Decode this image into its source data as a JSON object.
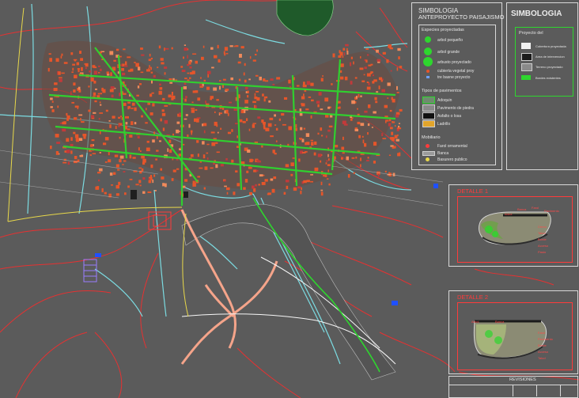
{
  "legend_left": {
    "title_line1": "SIMBOLOGIA",
    "title_line2": "ANTEPROYECTO PAISAJISMO",
    "section_species": "Especies proyectadas",
    "species": [
      "arbol pequeño",
      "arbol grande",
      "arbusto proyectado",
      "cubierta vegetal proy",
      "tre basne proyecto"
    ],
    "section_pavements": "Tipos de pavimentos",
    "pavements": [
      "Adoquin",
      "Pavimento de piedra",
      "Asfalto o losa",
      "Ladrillo"
    ],
    "section_furniture": "Mobiliario",
    "furniture": [
      "Farol ornamental",
      "Banca",
      "Basurero publico"
    ]
  },
  "legend_right": {
    "title": "SIMBOLOGIA",
    "section": "Proyecto del",
    "items": [
      "Cobertura proyectada",
      "Area de intervencion",
      "Terreno proyectado",
      "Bordes existentes"
    ]
  },
  "detail1": {
    "title": "DETALLE 1",
    "notes": [
      "Arbol",
      "Banca",
      "Farol",
      "Pavimento",
      "Cerco",
      "Talud",
      "Borde",
      "Acceso",
      "Pasto"
    ]
  },
  "detail2": {
    "title": "DETALLE 2",
    "notes": [
      "Arbol",
      "Banca",
      "Farol",
      "Pavimento",
      "Borde",
      "Acceso",
      "Talud"
    ]
  },
  "footer": {
    "label": "REVISIONES"
  },
  "colors": {
    "background": "#5b5b5b",
    "streets": "#2ed62e",
    "blocks": "#e6552a",
    "rivers": "#7fe9f0",
    "contours": "#ff2a2a",
    "roads": "#f5a48a"
  }
}
